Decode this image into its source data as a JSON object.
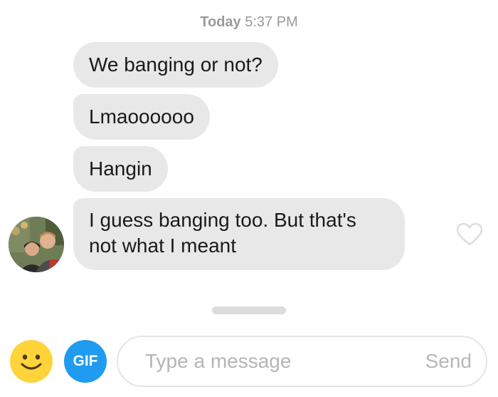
{
  "header": {
    "timestamp_day": "Today",
    "timestamp_time": "5:37 PM"
  },
  "messages": [
    {
      "text": "We banging or not?"
    },
    {
      "text": "Lmaoooooo"
    },
    {
      "text": "Hangin"
    },
    {
      "text": "I guess banging too. But that's not what I meant"
    }
  ],
  "composer": {
    "gif_label": "GIF",
    "placeholder": "Type a message",
    "send_label": "Send"
  },
  "icons": {
    "emoji": "smiley-face-icon",
    "like": "heart-outline-icon"
  },
  "colors": {
    "bubble": "#e8e8e8",
    "gif": "#1f9bf0",
    "emoji": "#ffd43b"
  }
}
